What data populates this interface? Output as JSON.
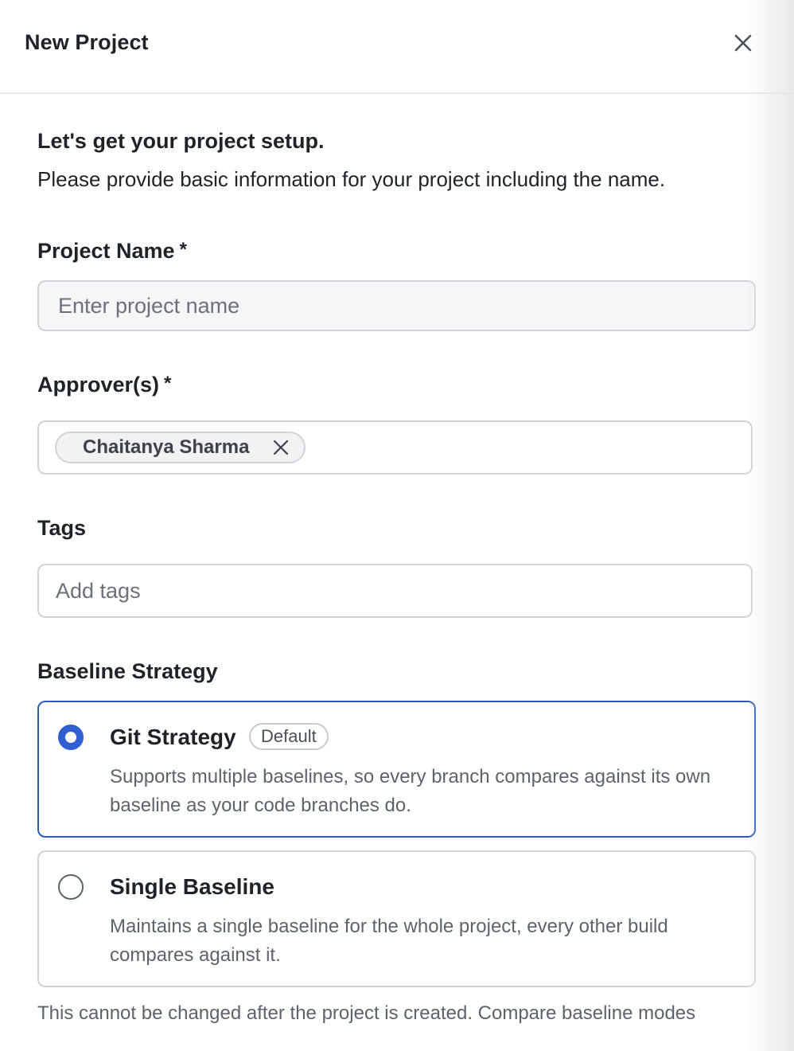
{
  "header": {
    "title": "New Project"
  },
  "intro": {
    "heading": "Let's get your project setup.",
    "text": "Please provide basic information for your project including the name."
  },
  "project_name": {
    "label": "Project Name",
    "required_mark": "*",
    "placeholder": "Enter project name",
    "value": ""
  },
  "approvers": {
    "label": "Approver(s)",
    "required_mark": "*",
    "selected": [
      "Chaitanya Sharma"
    ]
  },
  "tags": {
    "label": "Tags",
    "placeholder": "Add tags",
    "value": ""
  },
  "baseline_strategy": {
    "label": "Baseline Strategy",
    "options": [
      {
        "title": "Git Strategy",
        "badge": "Default",
        "description": "Supports multiple baselines, so every branch compares against its own baseline as your code branches do.",
        "selected": true
      },
      {
        "title": "Single Baseline",
        "description": "Maintains a single baseline for the whole project, every other build compares against it.",
        "selected": false
      }
    ],
    "footer_note": "This cannot be changed after the project is created. Compare baseline modes"
  },
  "colors": {
    "accent": "#2f5fd0",
    "selected_border": "#2f5bb7",
    "border": "#d0d4d9",
    "muted_text": "#5d636b"
  }
}
